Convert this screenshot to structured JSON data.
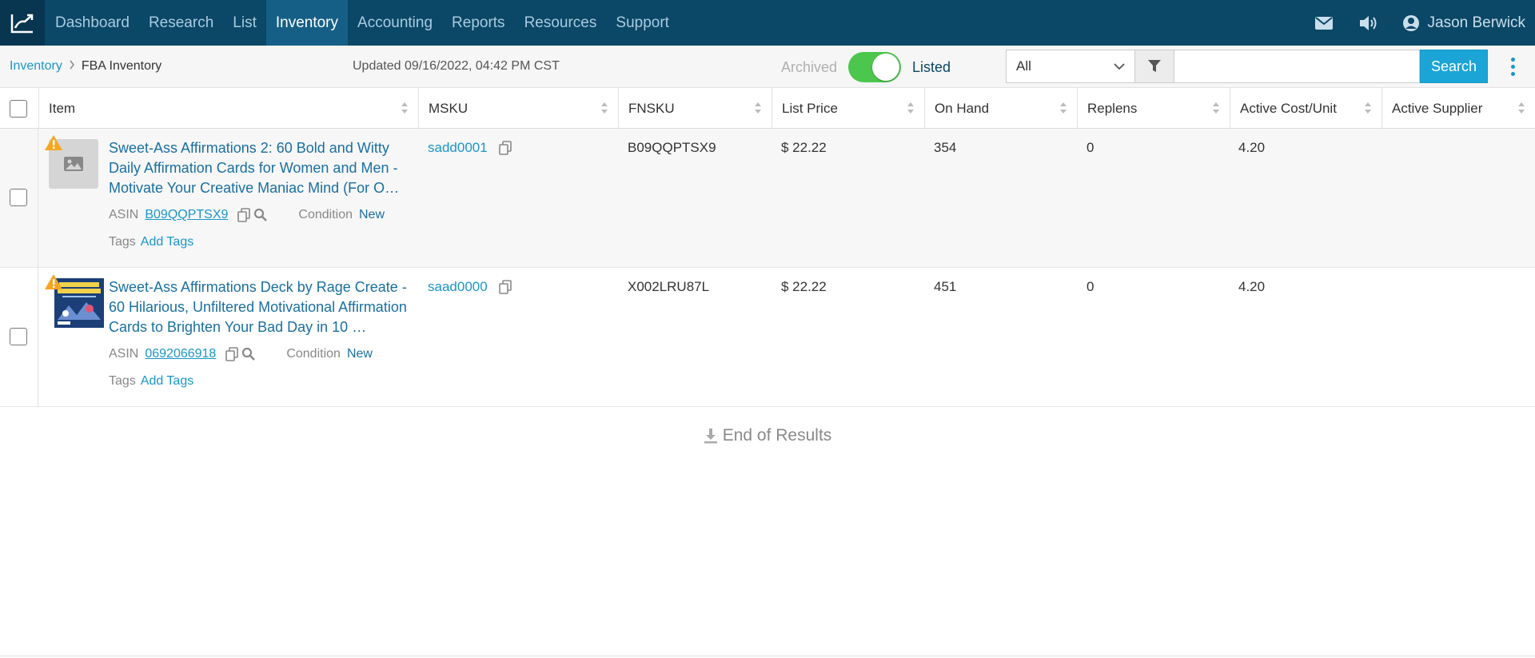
{
  "nav": {
    "items": [
      "Dashboard",
      "Research",
      "List",
      "Inventory",
      "Accounting",
      "Reports",
      "Resources",
      "Support"
    ],
    "active": "Inventory",
    "user_name": "Jason Berwick"
  },
  "toolbar": {
    "breadcrumb_root": "Inventory",
    "breadcrumb_current": "FBA Inventory",
    "updated": "Updated 09/16/2022, 04:42 PM CST",
    "toggle_off_label": "Archived",
    "toggle_on_label": "Listed",
    "toggle_state": "on",
    "filter_value": "All",
    "search_placeholder": "",
    "search_label": "Search"
  },
  "columns": [
    "Item",
    "MSKU",
    "FNSKU",
    "List Price",
    "On Hand",
    "Replens",
    "Active Cost/Unit",
    "Active Supplier"
  ],
  "rows": [
    {
      "title": "Sweet-Ass Affirmations 2: 60 Bold and Witty Daily Affirmation Cards for Women and Men - Motivate Your Creative Maniac Mind (For O…",
      "asin_label": "ASIN",
      "asin": "B09QQPTSX9",
      "condition_label": "Condition",
      "condition": "New",
      "tags_label": "Tags",
      "tags_action": "Add Tags",
      "msku": "sadd0001",
      "fnsku": "B09QQPTSX9",
      "list_price": "$ 22.22",
      "on_hand": "354",
      "replens": "0",
      "active_cost": "4.20",
      "active_supplier": ""
    },
    {
      "title": "Sweet-Ass Affirmations Deck by Rage Create - 60 Hilarious, Unfiltered Motivational Affirmation Cards to Brighten Your Bad Day in 10 …",
      "asin_label": "ASIN",
      "asin": "0692066918",
      "condition_label": "Condition",
      "condition": "New",
      "tags_label": "Tags",
      "tags_action": "Add Tags",
      "msku": "saad0000",
      "fnsku": "X002LRU87L",
      "list_price": "$ 22.22",
      "on_hand": "451",
      "replens": "0",
      "active_cost": "4.20",
      "active_supplier": ""
    }
  ],
  "footer": {
    "end_label": "End of Results"
  },
  "colors": {
    "nav_bg": "#0b4766",
    "nav_active": "#155f86",
    "accent": "#1a96c8",
    "toggle_on": "#4cc74d",
    "warning": "#f5a623"
  }
}
